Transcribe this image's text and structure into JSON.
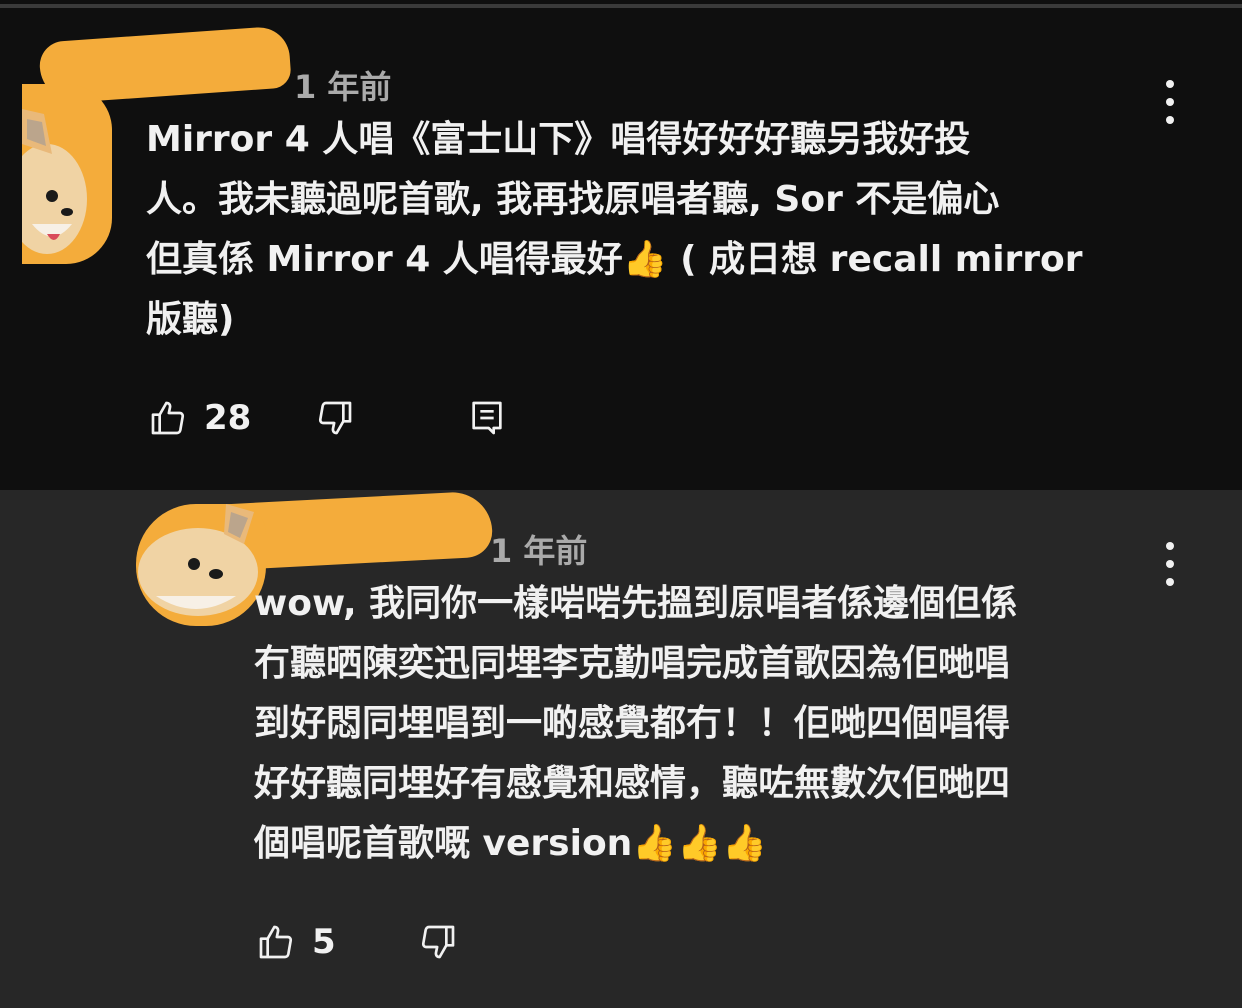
{
  "comments": [
    {
      "time": "1 年前",
      "lines": [
        "Mirror 4 人唱《富士山下》唱得好好好聽另我好投",
        "人。我未聽過呢首歌, 我再找原唱者聽, Sor 不是偏心",
        "但真係 Mirror 4 人唱得最好👍 ( 成日想 recall mirror",
        "版聽)"
      ],
      "likes": "28",
      "icons": [
        "thumb-up-icon",
        "thumb-down-icon",
        "reply-icon",
        "more-vert-icon"
      ]
    },
    {
      "time": "1 年前",
      "lines": [
        "wow, 我同你一樣啱啱先搵到原唱者係邊個但係",
        "冇聽晒陳奕迅同埋李克勤唱完成首歌因為佢哋唱",
        "到好悶同埋唱到一啲感覺都冇！！佢哋四個唱得",
        "好好聽同埋好有感覺和感情，聽咗無數次佢哋四",
        "個唱呢首歌嘅 version👍👍👍"
      ],
      "likes": "5",
      "icons": [
        "thumb-up-icon",
        "thumb-down-icon",
        "more-vert-icon"
      ]
    }
  ],
  "colors": {
    "background": "#0f0f0f",
    "reply_background": "#272727",
    "text": "#f1f1f1",
    "meta": "#aaaaaa",
    "avatar_orange": "#f4ac3b"
  }
}
